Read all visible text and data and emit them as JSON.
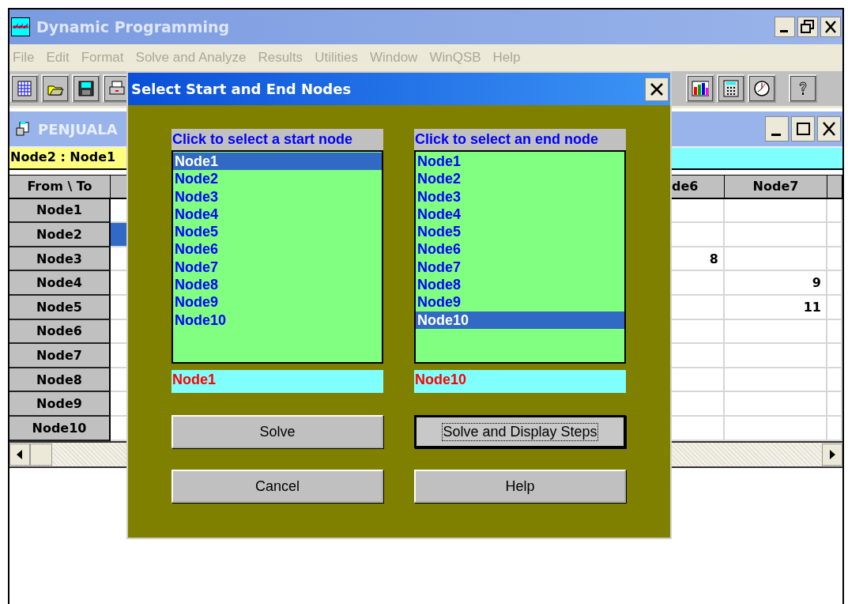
{
  "window": {
    "title": "Dynamic Programming"
  },
  "menu": [
    {
      "label": "File",
      "disabled": true
    },
    {
      "label": "Edit",
      "disabled": true
    },
    {
      "label": "Format",
      "disabled": true
    },
    {
      "label": "Solve and Analyze",
      "disabled": true
    },
    {
      "label": "Results",
      "disabled": true
    },
    {
      "label": "Utilities",
      "disabled": true
    },
    {
      "label": "Window",
      "disabled": true
    },
    {
      "label": "WinQSB",
      "disabled": true
    },
    {
      "label": "Help",
      "disabled": true
    }
  ],
  "toolbar": {
    "left": [
      {
        "kind": "grid"
      },
      {
        "kind": "folder"
      },
      {
        "kind": "floppy"
      },
      {
        "kind": "printer"
      }
    ],
    "right": [
      {
        "kind": "chart"
      },
      {
        "kind": "calculator"
      },
      {
        "kind": "clock"
      },
      {
        "kind": "help"
      }
    ]
  },
  "child_window": {
    "title": "PENJUALA",
    "cell_reference": "Node2 : Node1",
    "table": {
      "columns": [
        {
          "label": "From \\ To"
        },
        {
          "label": "de6"
        },
        {
          "label": "Node7"
        }
      ],
      "rows": [
        {
          "label": "Node1",
          "selected": false
        },
        {
          "label": "Node2",
          "selected": true
        },
        {
          "label": "Node3",
          "selected": false,
          "column_2": "8"
        },
        {
          "label": "Node4",
          "selected": false,
          "node7": "9"
        },
        {
          "label": "Node5",
          "selected": false,
          "node7": "11"
        },
        {
          "label": "Node6",
          "selected": false
        },
        {
          "label": "Node7",
          "selected": false
        },
        {
          "label": "Node8",
          "selected": false
        },
        {
          "label": "Node9",
          "selected": false
        },
        {
          "label": "Node10",
          "selected": false
        }
      ]
    }
  },
  "dialog": {
    "title": "Select Start and End Nodes",
    "lists": [
      {
        "heading": "Click to select a start node",
        "value": "Node1",
        "items": [
          {
            "label": "Node1",
            "selected": true
          },
          {
            "label": "Node2",
            "selected": false
          },
          {
            "label": "Node3",
            "selected": false
          },
          {
            "label": "Node4",
            "selected": false
          },
          {
            "label": "Node5",
            "selected": false
          },
          {
            "label": "Node6",
            "selected": false
          },
          {
            "label": "Node7",
            "selected": false
          },
          {
            "label": "Node8",
            "selected": false
          },
          {
            "label": "Node9",
            "selected": false
          },
          {
            "label": "Node10",
            "selected": false
          }
        ]
      },
      {
        "heading": "Click to select an end node",
        "value": "Node10",
        "items": [
          {
            "label": "Node1",
            "selected": false
          },
          {
            "label": "Node2",
            "selected": false
          },
          {
            "label": "Node3",
            "selected": false
          },
          {
            "label": "Node4",
            "selected": false
          },
          {
            "label": "Node5",
            "selected": false
          },
          {
            "label": "Node6",
            "selected": false
          },
          {
            "label": "Node7",
            "selected": false
          },
          {
            "label": "Node8",
            "selected": false
          },
          {
            "label": "Node9",
            "selected": false
          },
          {
            "label": "Node10",
            "selected": true
          }
        ]
      }
    ],
    "buttons": [
      {
        "label": "Solve",
        "focused": false
      },
      {
        "label": "Solve and Display Steps",
        "focused": true
      },
      {
        "label": "Cancel",
        "focused": false
      },
      {
        "label": "Help",
        "focused": false
      }
    ]
  }
}
